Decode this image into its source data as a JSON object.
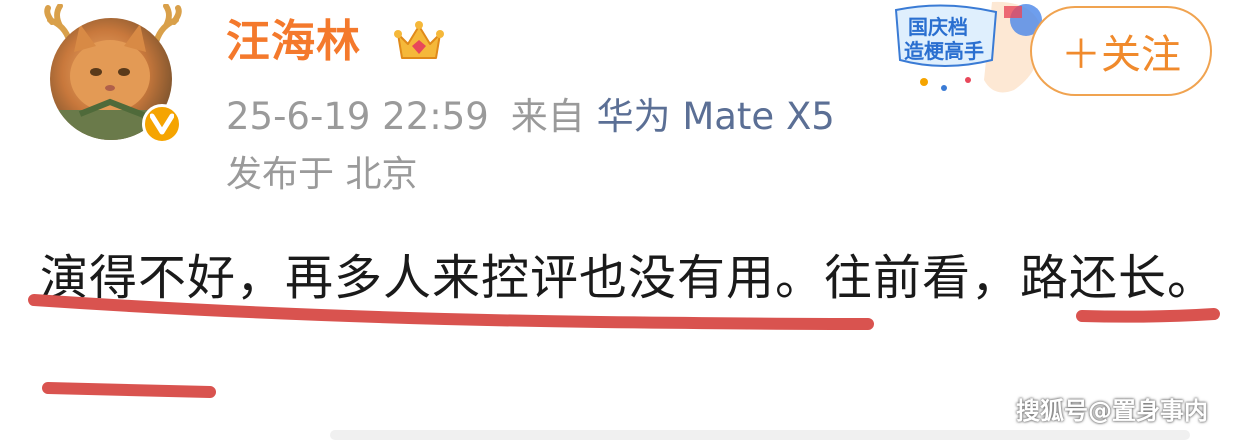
{
  "user": {
    "name": "汪海林",
    "timestamp": "25-6-19 22:59",
    "source_prefix": "来自",
    "device": "华为 Mate X5",
    "location": "发布于 北京"
  },
  "follow_button": {
    "label": "＋关注"
  },
  "badge": {
    "line1": "国庆档",
    "line2": "造梗高手"
  },
  "post": {
    "text": "演得不好，再多人来控评也没有用。往前看，路还长。"
  },
  "watermark": "搜狐号@置身事内",
  "colors": {
    "username": "#f4792c",
    "device_link": "#5b6f95",
    "meta_gray": "#9a9a9a",
    "follow_border": "#f0a350",
    "annotation_red": "#d9534f"
  }
}
